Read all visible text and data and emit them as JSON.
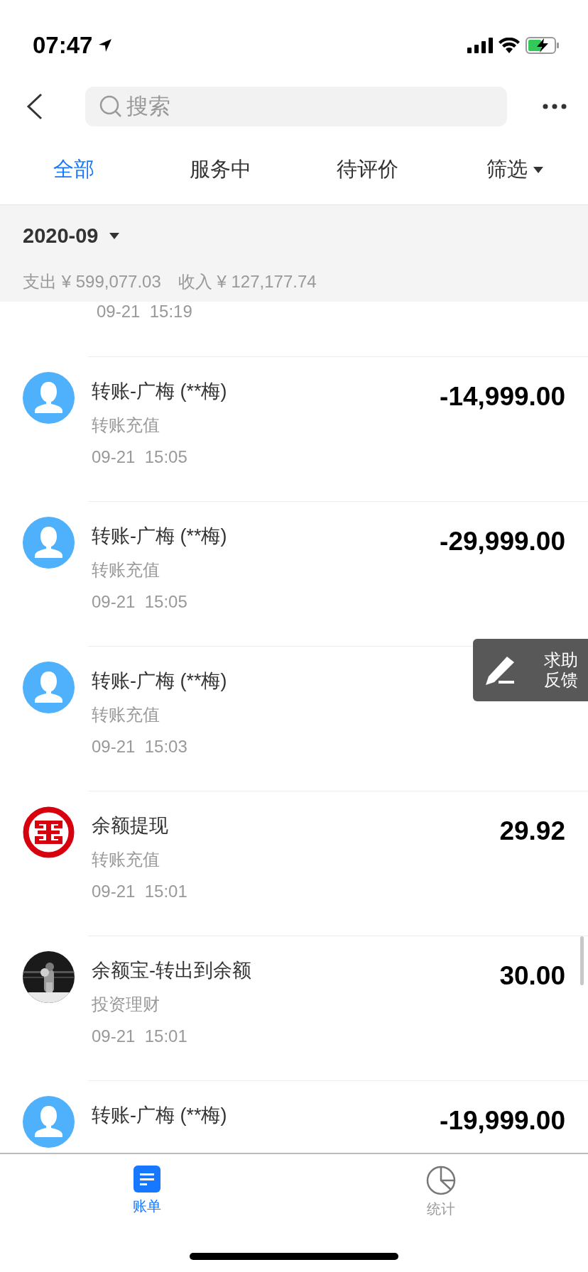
{
  "status_bar": {
    "time": "07:47"
  },
  "search": {
    "placeholder": "搜索"
  },
  "tabs": [
    {
      "label": "全部",
      "selected": true,
      "kind": "tab"
    },
    {
      "label": "服务中",
      "selected": false,
      "kind": "tab"
    },
    {
      "label": "待评价",
      "selected": false,
      "kind": "tab"
    },
    {
      "label": "筛选",
      "selected": false,
      "kind": "dropdown"
    }
  ],
  "summary": {
    "month": "2020-09",
    "expense_label": "支出",
    "expense": "¥ 599,077.03",
    "income_label": "收入",
    "income": "¥ 127,177.74"
  },
  "transactions": [
    {
      "time": "09-21  15:19"
    },
    {
      "kind": "person",
      "title": "转账-广梅 (**梅)",
      "category": "转账充值",
      "time": "09-21  15:05",
      "amount": "-14,999.00"
    },
    {
      "kind": "person",
      "title": "转账-广梅 (**梅)",
      "category": "转账充值",
      "time": "09-21  15:05",
      "amount": "-29,999.00"
    },
    {
      "kind": "person",
      "title": "转账-广梅 (**梅)",
      "category": "转账充值",
      "time": "09-21  15:03"
    },
    {
      "kind": "bank",
      "title": "余额提现",
      "category": "转账充值",
      "time": "09-21  15:01",
      "amount": "29.92"
    },
    {
      "kind": "picture",
      "title": "余额宝-转出到余额",
      "category": "投资理财",
      "time": "09-21  15:01",
      "amount": "30.00"
    },
    {
      "kind": "person",
      "title": "转账-广梅 (**梅)",
      "amount": "-19,999.00"
    }
  ],
  "feedback": {
    "label": "求助反馈"
  },
  "bottom_nav": [
    {
      "label": "账单",
      "selected": true,
      "kind": "bill"
    },
    {
      "label": "统计",
      "selected": false,
      "kind": "stats"
    }
  ]
}
